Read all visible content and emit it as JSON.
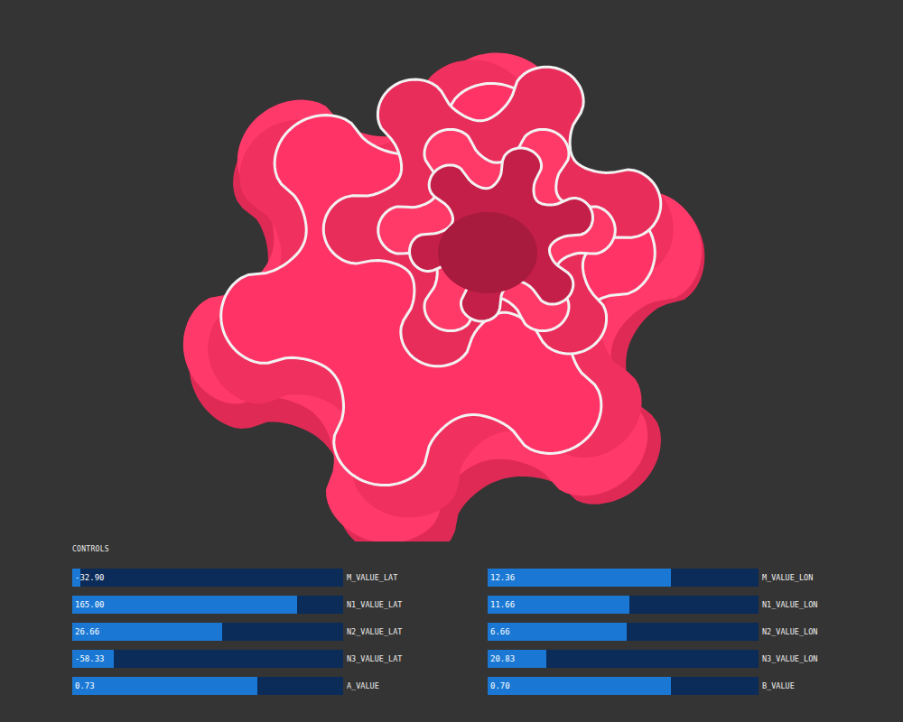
{
  "controls": {
    "title": "CONTROLS",
    "left": [
      {
        "label": "M_VALUE_LAT",
        "reading": "-32.90",
        "level": 0.03
      },
      {
        "label": "N1_VALUE_LAT",
        "reading": "165.00",
        "level": 0.83
      },
      {
        "label": "N2_VALUE_LAT",
        "reading": "26.66",
        "level": 0.553
      },
      {
        "label": "N3_VALUE_LAT",
        "reading": "-58.33",
        "level": 0.153
      },
      {
        "label": "A_VALUE",
        "reading": "0.73",
        "level": 0.683
      }
    ],
    "right": [
      {
        "label": "M_VALUE_LON",
        "reading": "12.36",
        "level": 0.677
      },
      {
        "label": "N1_VALUE_LON",
        "reading": "11.66",
        "level": 0.523
      },
      {
        "label": "N2_VALUE_LON",
        "reading": "6.66",
        "level": 0.513
      },
      {
        "label": "N3_VALUE_LON",
        "reading": "20.83",
        "level": 0.217
      },
      {
        "label": "B_VALUE",
        "reading": "0.70",
        "level": 0.677
      }
    ]
  }
}
